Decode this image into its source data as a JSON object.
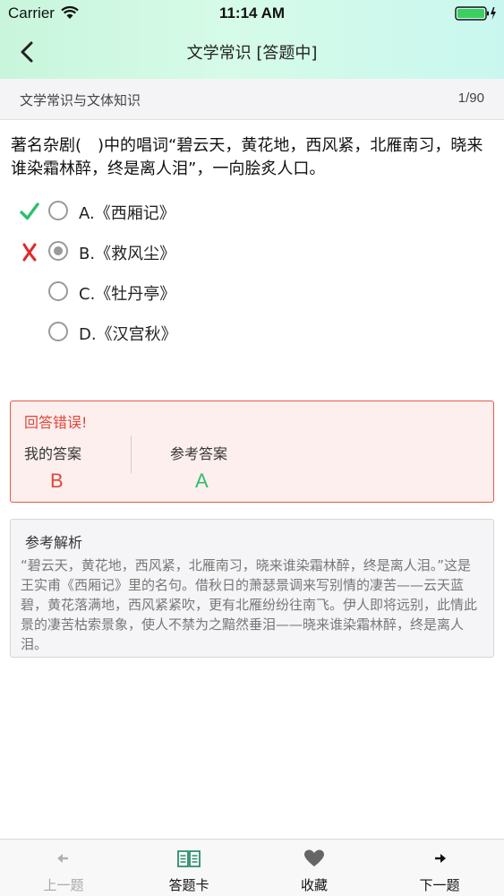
{
  "status_bar": {
    "carrier": "Carrier",
    "time": "11:14 AM"
  },
  "nav": {
    "title": "文学常识 [答题中]"
  },
  "subheader": {
    "category": "文学常识与文体知识",
    "progress": "1/90"
  },
  "question": {
    "text": "著名杂剧(　)中的唱词“碧云天，黄花地，西风紧，北雁南习，晓来谁染霜林醉，终是离人泪”，一向脍炙人口。",
    "options": [
      {
        "label": "A.《西厢记》",
        "mark": "correct",
        "selected": false
      },
      {
        "label": "B.《救风尘》",
        "mark": "wrong",
        "selected": true
      },
      {
        "label": "C.《牡丹亭》",
        "mark": "",
        "selected": false
      },
      {
        "label": "D.《汉宫秋》",
        "mark": "",
        "selected": false
      }
    ]
  },
  "result": {
    "title": "回答错误!",
    "my_answer_label": "我的答案",
    "my_answer": "B",
    "ref_answer_label": "参考答案",
    "ref_answer": "A"
  },
  "analysis": {
    "title": "参考解析",
    "text": "“碧云天，黄花地，西风紧，北雁南习，晓来谁染霜林醉，终是离人泪。”这是王实甫《西厢记》里的名句。借秋日的萧瑟景调来写别情的凄苦——云天蓝碧，黄花落满地，西风紧紧吹，更有北雁纷纷往南飞。伊人即将远别，此情此景的凄苦枯索景象，使人不禁为之黯然垂泪——晓来谁染霜林醉，终是离人泪。"
  },
  "tabbar": {
    "prev": "上一题",
    "card": "答题卡",
    "favorite": "收藏",
    "next": "下一题"
  },
  "colors": {
    "correct": "#2fbf6e",
    "wrong": "#e0483a",
    "header_gradient": "#c8f5dc"
  },
  "icons": {
    "back": "chevron-left-icon",
    "correct": "checkmark-icon",
    "wrong": "cross-icon",
    "prev": "arrow-left-icon",
    "card": "book-icon",
    "favorite": "heart-icon",
    "next": "arrow-right-icon"
  }
}
